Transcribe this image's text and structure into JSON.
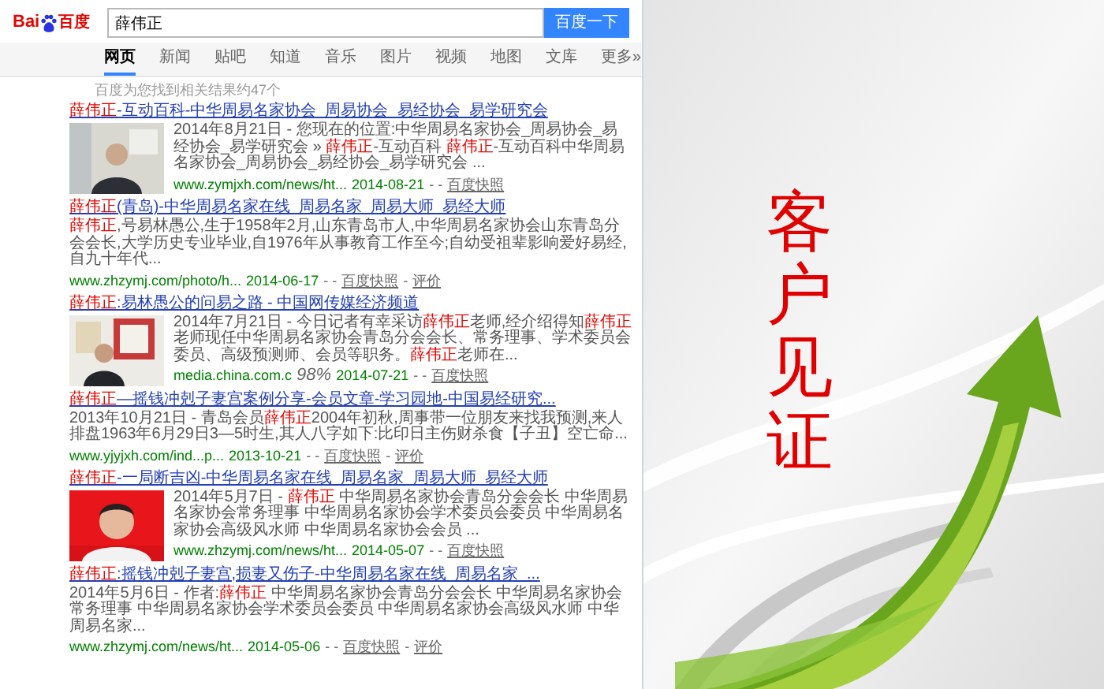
{
  "search": {
    "logo_left": "Bai",
    "logo_right": "百度",
    "query": "薛伟正",
    "button": "百度一下"
  },
  "tabs": [
    {
      "label": "网页",
      "selected": true
    },
    {
      "label": "新闻",
      "selected": false
    },
    {
      "label": "贴吧",
      "selected": false
    },
    {
      "label": "知道",
      "selected": false
    },
    {
      "label": "音乐",
      "selected": false
    },
    {
      "label": "图片",
      "selected": false
    },
    {
      "label": "视频",
      "selected": false
    },
    {
      "label": "地图",
      "selected": false
    },
    {
      "label": "文库",
      "selected": false
    },
    {
      "label": "更多»",
      "selected": false
    }
  ],
  "result_count": "百度为您找到相关结果约47个",
  "link_separator": "-",
  "results": [
    {
      "kind": "picture",
      "title_keyword": "薛伟正",
      "title_rest": "-互动百科-中华周易名家协会_周易协会_易经协会_易学研究会",
      "snippet": [
        {
          "text": "2014年8月21日 - 您现在的位置:中华周易名家协会_周易协会_易经协会_易学研究会 » ",
          "highlight": false
        },
        {
          "text": "薛伟正",
          "highlight": true
        },
        {
          "text": "-互动百科 ",
          "highlight": false
        },
        {
          "text": "薛伟正",
          "highlight": true
        },
        {
          "text": "-互动百科中华周易名家协会_周易协会_易经协会_易学研究会 ...",
          "highlight": false
        }
      ],
      "url": "www.zymjxh.com/news/ht...",
      "date": "2014-08-21",
      "dashes": "- -",
      "links": [
        "百度快照"
      ]
    },
    {
      "kind": "plain",
      "title_keyword": "薛伟正",
      "title_rest": "(青岛)-中华周易名家在线_周易名家_周易大师_易经大师",
      "snippet": [
        {
          "text": "薛伟正",
          "highlight": true
        },
        {
          "text": ",号易林愚公,生于1958年2月,山东青岛市人,中华周易名家协会山东青岛分会会长,大学历史专业毕业,自1976年从事教育工作至今;自幼受祖辈影响爱好易经,自九十年代...",
          "highlight": false
        }
      ],
      "url": "www.zhzymj.com/photo/h...",
      "date": "2014-06-17",
      "dashes": "- -",
      "links": [
        "百度快照",
        "评价"
      ]
    },
    {
      "kind": "picture",
      "title_keyword": "薛伟正",
      "title_rest": ":易林愚公的问易之路 - 中国网传媒经济频道",
      "snippet": [
        {
          "text": "2014年7月21日 - 今日记者有幸采访",
          "highlight": false
        },
        {
          "text": "薛伟正",
          "highlight": true
        },
        {
          "text": "老师,经介绍得知",
          "highlight": false
        },
        {
          "text": "薛伟正",
          "highlight": true
        },
        {
          "text": "老师现任中华周易名家协会青岛分会会长、常务理事、学术委员会委员、高级预测师、会员等职务。",
          "highlight": false
        },
        {
          "text": "薛伟正",
          "highlight": true
        },
        {
          "text": "老师在...",
          "highlight": false
        }
      ],
      "url": "media.china.com.c",
      "overlay": "98%",
      "date": "2014-07-21",
      "dashes": "- -",
      "links": [
        "百度快照"
      ]
    },
    {
      "kind": "plain",
      "title_keyword": "薛伟正",
      "title_rest": "—摇钱冲剋子妻宫案例分享-会员文章-学习园地-中国易经研究...",
      "snippet": [
        {
          "text": "2013年10月21日 - 青岛会员",
          "highlight": false
        },
        {
          "text": "薛伟正",
          "highlight": true
        },
        {
          "text": "2004年初秋,周事带一位朋友来找我预测,来人排盘1963年6月29日3—5时生,其人八字如下:比印日主伤财杀食【子丑】空亡命...",
          "highlight": false
        }
      ],
      "url": "www.yjyjxh.com/ind...p...",
      "date": "2013-10-21",
      "dashes": "- -",
      "links": [
        "百度快照",
        "评价"
      ]
    },
    {
      "kind": "picture",
      "title_keyword": "薛伟正",
      "title_rest": "-一局断吉凶-中华周易名家在线_周易名家_周易大师_易经大师",
      "snippet": [
        {
          "text": "2014年5月7日 - ",
          "highlight": false
        },
        {
          "text": "薛伟正",
          "highlight": true
        },
        {
          "text": " 中华周易名家协会青岛分会会长 中华周易名家协会常务理事 中华周易名家协会学术委员会委员 中华周易名家协会高级风水师 中华周易名家协会会员 ...",
          "highlight": false
        }
      ],
      "url": "www.zhzymj.com/news/ht...",
      "date": "2014-05-07",
      "dashes": "- -",
      "links": [
        "百度快照"
      ]
    },
    {
      "kind": "plain",
      "title_keyword": "薛伟正",
      "title_rest": ":摇钱冲剋子妻宫,损妻又伤子-中华周易名家在线_周易名家_...",
      "snippet": [
        {
          "text": "2014年5月6日 - 作者:",
          "highlight": false
        },
        {
          "text": "薛伟正",
          "highlight": true
        },
        {
          "text": " 中华周易名家协会青岛分会会长 中华周易名家协会常务理事 中华周易名家协会学术委员会委员 中华周易名家协会高级风水师 中华周易名家...",
          "highlight": false
        }
      ],
      "url": "www.zhzymj.com/news/ht...",
      "date": "2014-05-06",
      "dashes": "- -",
      "links": [
        "百度快照",
        "评价"
      ]
    }
  ],
  "slide": {
    "heading": "客户见证"
  }
}
